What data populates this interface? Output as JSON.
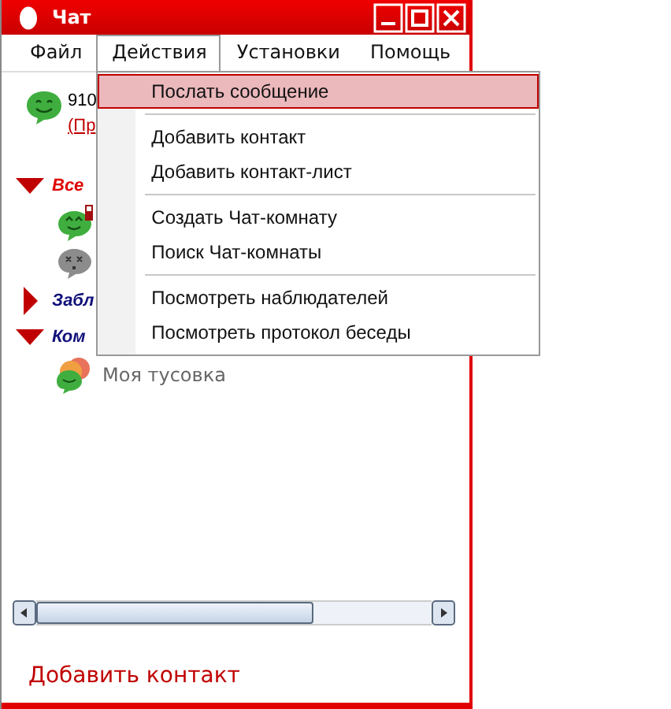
{
  "window": {
    "title": "Чат"
  },
  "menu": [
    {
      "label": "Файл",
      "selected": false
    },
    {
      "label": "Действия",
      "selected": true
    },
    {
      "label": "Установки",
      "selected": false
    },
    {
      "label": "Помощь",
      "selected": false
    }
  ],
  "dropdown": [
    [
      {
        "label": "Послать сообщение",
        "selected": true
      }
    ],
    [
      {
        "label": "Добавить контакт",
        "selected": false
      },
      {
        "label": "Добавить контакт-лист",
        "selected": false
      }
    ],
    [
      {
        "label": "Создать Чат-комнату",
        "selected": false
      },
      {
        "label": "Поиск Чат-комнаты",
        "selected": false
      }
    ],
    [
      {
        "label": "Посмотреть наблюдателей",
        "selected": false
      },
      {
        "label": "Посмотреть протокол беседы",
        "selected": false
      }
    ]
  ],
  "account": {
    "name": "910",
    "status_link": "(Пр"
  },
  "groups": [
    {
      "name": "Все",
      "expanded": true,
      "color": "#e00000",
      "contacts": [
        {
          "kind": "online_phone"
        },
        {
          "kind": "offline"
        }
      ]
    },
    {
      "name": "Забл",
      "expanded": false,
      "color": "#10107a"
    },
    {
      "name": "Ком",
      "expanded": true,
      "color": "#10107a",
      "contacts": [
        {
          "kind": "chatroom",
          "name": "Моя тусовка"
        }
      ]
    }
  ],
  "footer_link": "Добавить контакт"
}
